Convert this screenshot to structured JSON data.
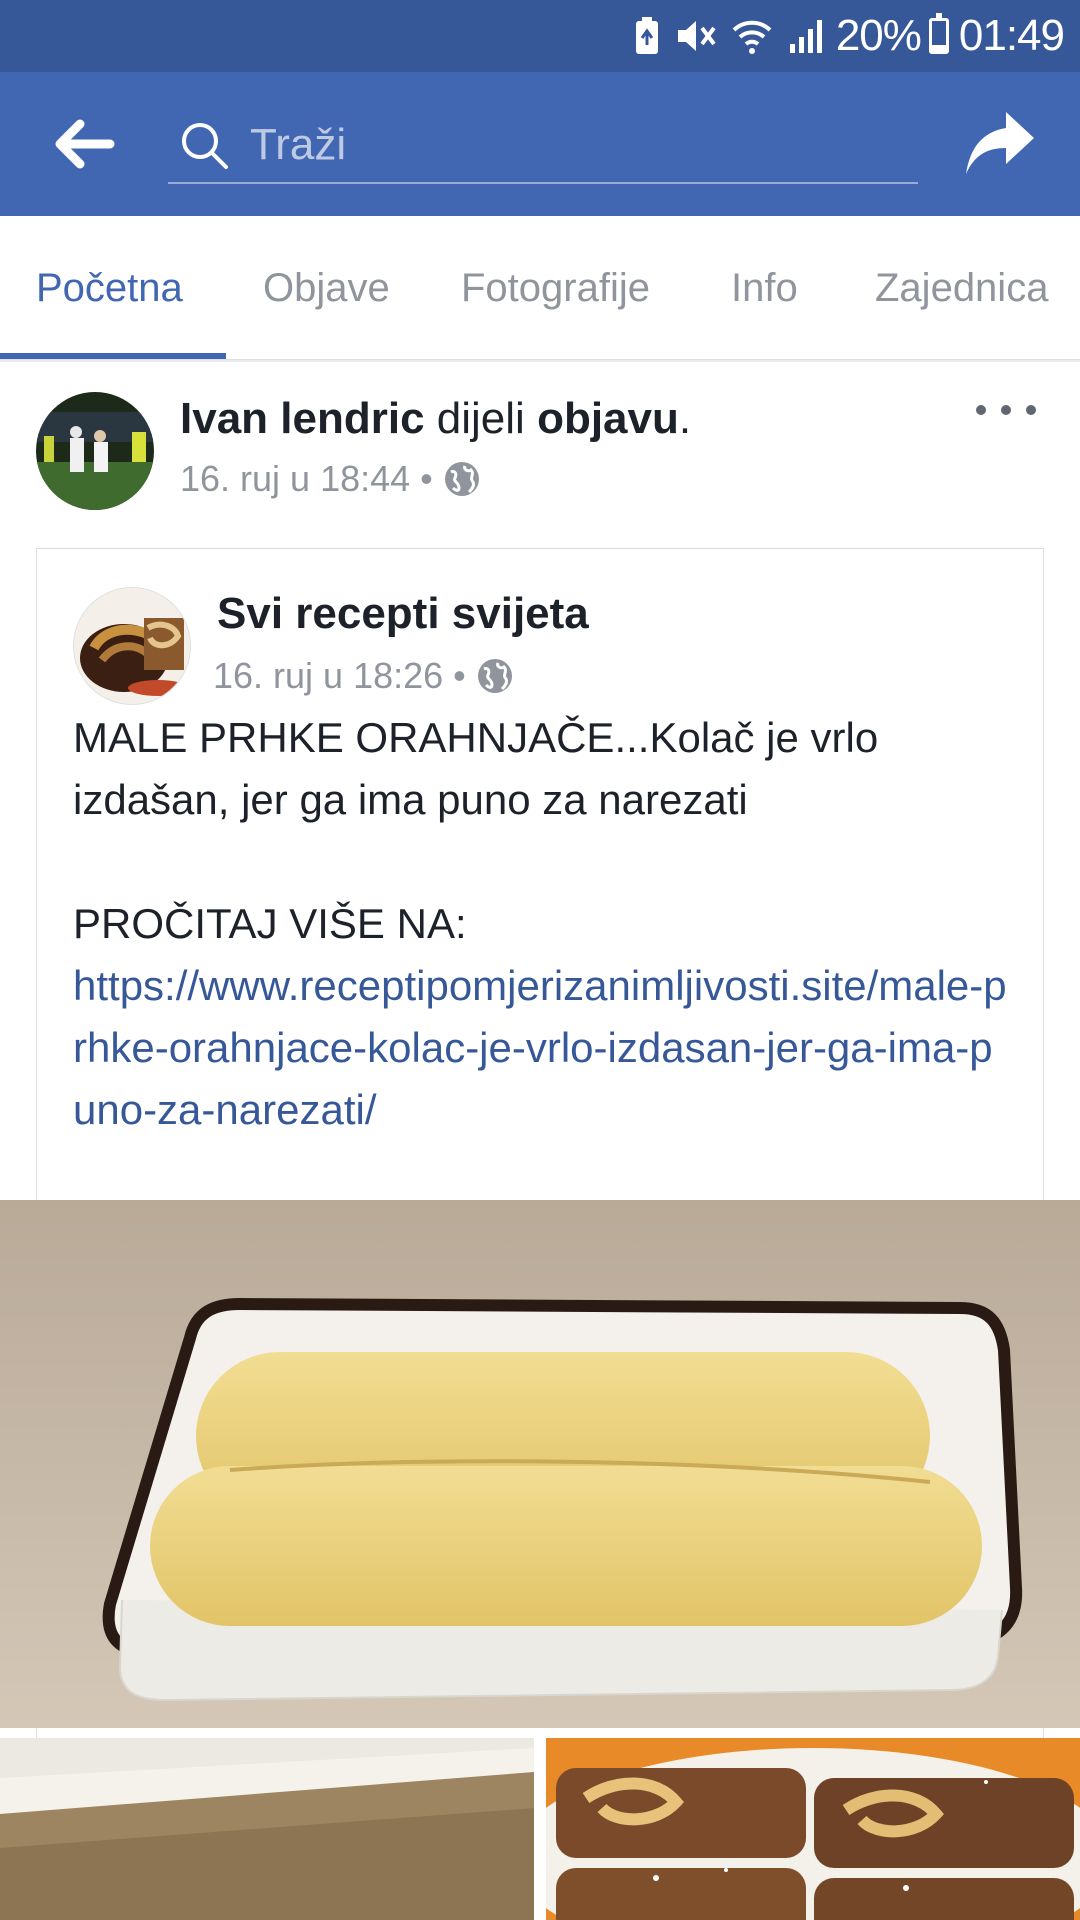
{
  "status_bar": {
    "battery": "20%",
    "time": "01:49",
    "battery_level": 0.2,
    "icons": [
      "battery-saver-icon",
      "mute-icon",
      "wifi-icon",
      "signal-icon",
      "battery-icon"
    ]
  },
  "search": {
    "placeholder": "Traži",
    "icons": [
      "back-arrow-icon",
      "search-icon",
      "share-icon"
    ]
  },
  "tabs": [
    "Početna",
    "Objave",
    "Fotografije",
    "Info",
    "Zajednica"
  ],
  "active_tab": "Početna",
  "post": {
    "author": "Ivan lendric",
    "action": "dijeli",
    "object": "objavu",
    "period": ".",
    "time": "16. ruj u 18:44",
    "dot": "•",
    "privacy_icon": "globe-icon",
    "shared": {
      "page_name": "Svi recepti svijeta",
      "time": "16. ruj u 18:26",
      "dot": "•",
      "text_line1": "MALE PRHKE ORAHNJAČE...Kolač je vrlo izdašan, jer ga ima puno za narezati",
      "read_more": "PROČITAJ VIŠE NA:",
      "link": "https://www.receptipomjerizanimljivosti.site/male-prhke-orahnjace-kolac-je-vrlo-izdasan-jer-ga-ima-puno-za-narezati/"
    }
  },
  "colors": {
    "status_bar": "#365899",
    "app_bar": "#4267b2",
    "accent": "#4267b2",
    "link": "#365899",
    "muted": "#90949c"
  }
}
